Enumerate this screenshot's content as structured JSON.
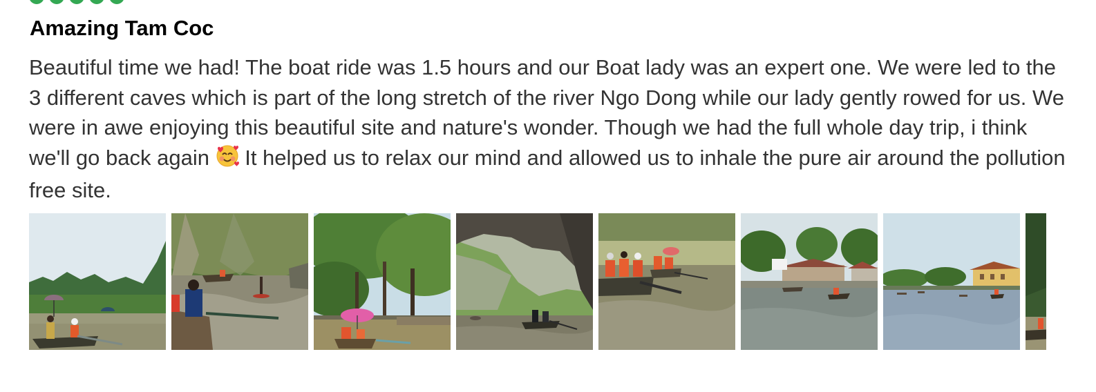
{
  "review": {
    "rating_bubbles": 5,
    "title": "Amazing Tam Coc",
    "text_before_emoji": "Beautiful time we had! The boat ride was 1.5 hours and our Boat lady was an expert one. We were led to the 3 different caves which is part of the long stretch of the river Ngo Dong while our lady gently rowed for us. We were in awe enjoying this beautiful site and nature's wonder. Though we had the full whole day trip, i think we'll go back again",
    "emoji_icon": "smiling-face-with-hearts-icon",
    "text_after_emoji": " It helped us to relax our mind and allowed us to inhale the pure air around the pollution free site."
  },
  "photos": [
    {
      "scene": "boats-with-umbrella-karst-mountains"
    },
    {
      "scene": "boat-rowing-near-cliffs"
    },
    {
      "scene": "pink-umbrella-under-trees"
    },
    {
      "scene": "boat-under-cave-rock"
    },
    {
      "scene": "tourists-in-orange-life-vests"
    },
    {
      "scene": "riverside-buildings"
    },
    {
      "scene": "wide-river-yellow-building"
    },
    {
      "scene": "partial-cliff-boat"
    }
  ],
  "colors": {
    "rating_bubble": "#34a853",
    "title": "#000000",
    "body_text": "#333333"
  }
}
